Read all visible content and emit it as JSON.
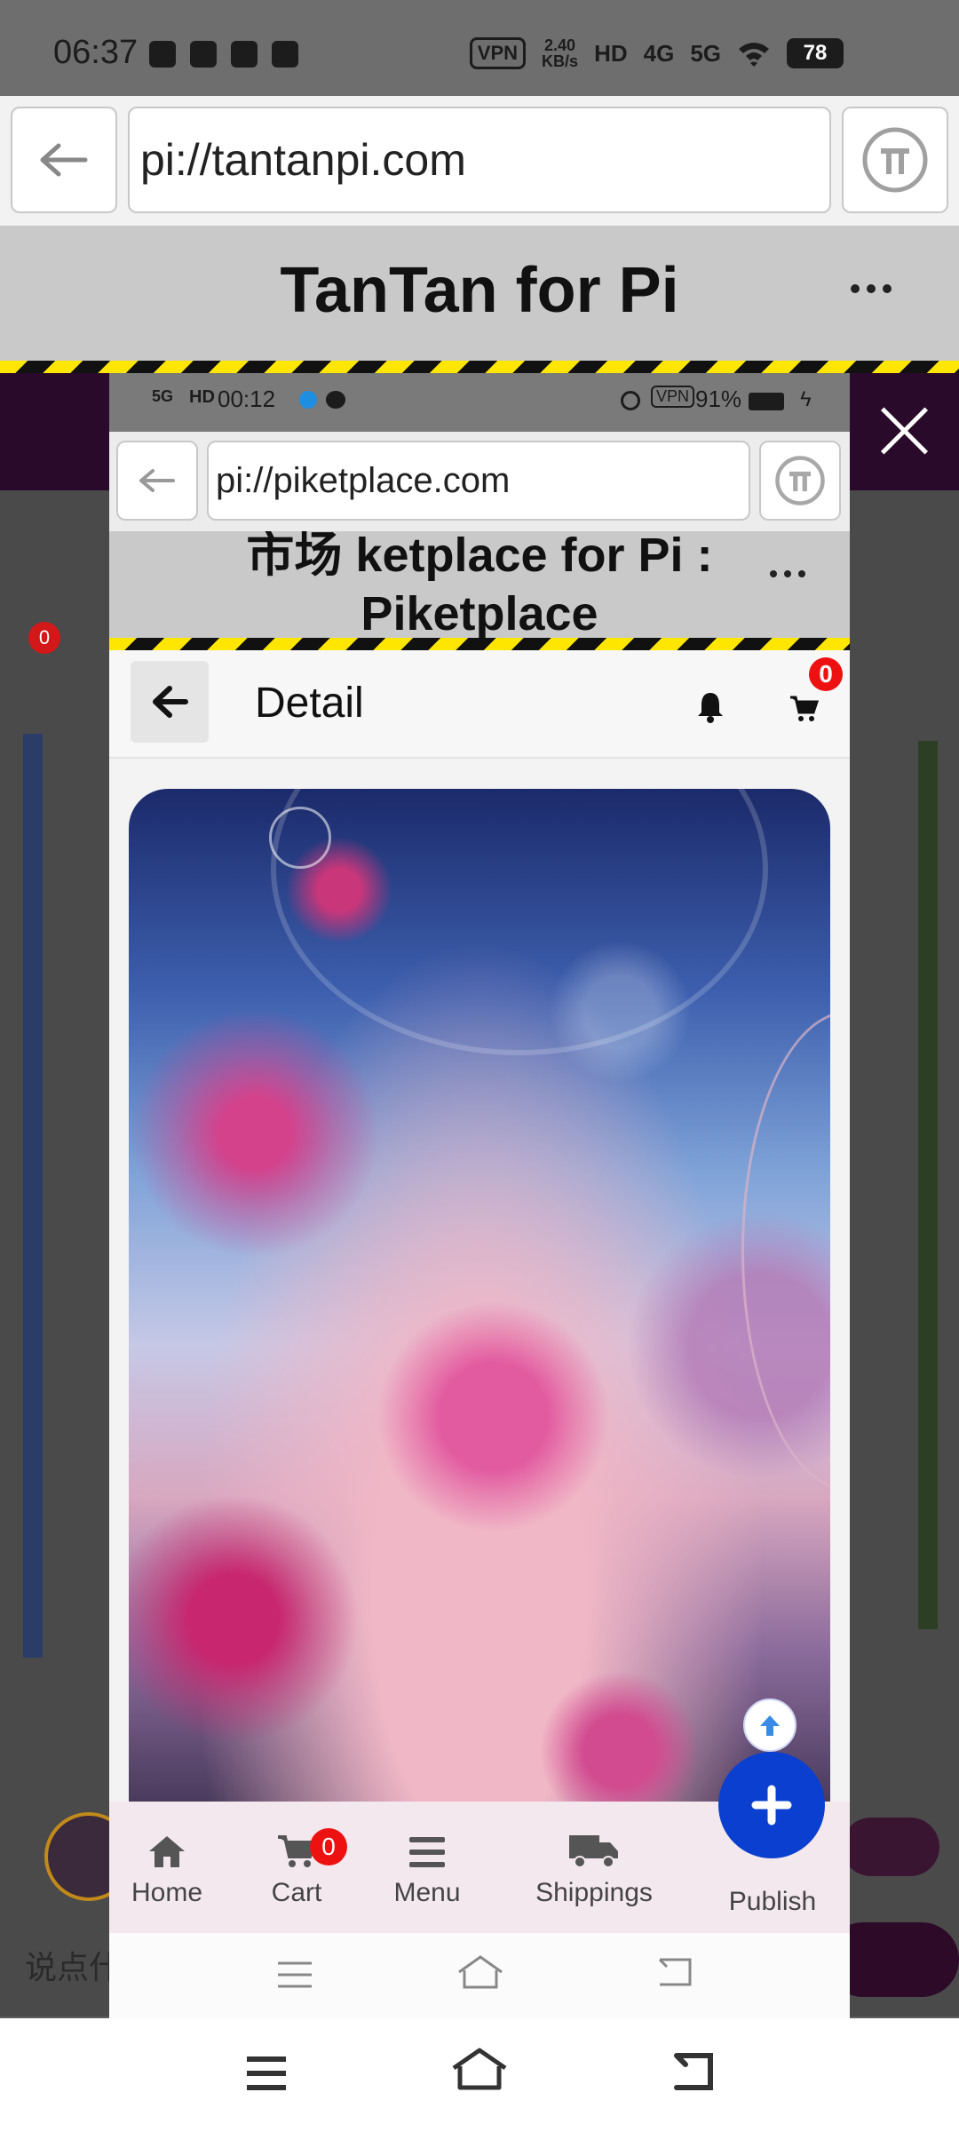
{
  "status_bar": {
    "time": "06:37",
    "vpn": "VPN",
    "speed": "2.40",
    "speed_unit": "KB/s",
    "hd": "HD",
    "net1": "4G",
    "net2": "5G",
    "battery": "78"
  },
  "outer_browser": {
    "url": "pi://tantanpi.com",
    "title": "TanTan for Pi"
  },
  "inner_status": {
    "time": "00:12",
    "net": "5G",
    "hd": "HD",
    "vpn": "VPN",
    "battery": "91%"
  },
  "inner_browser": {
    "url": "pi://piketplace.com",
    "title_line1": "市场 ketplace for Pi :",
    "title_line2": "Piketplace"
  },
  "detail": {
    "title": "Detail",
    "cart_count": "0"
  },
  "bottom_nav": [
    {
      "label": "Home",
      "icon": "home-icon"
    },
    {
      "label": "Cart",
      "icon": "cart-icon",
      "badge": "0"
    },
    {
      "label": "Menu",
      "icon": "menu-icon"
    },
    {
      "label": "Shippings",
      "icon": "truck-icon"
    },
    {
      "label": "Publish",
      "icon": "plus-icon"
    }
  ],
  "background": {
    "badge": "0",
    "input_placeholder": "说点什"
  },
  "colors": {
    "fab": "#0a3fcf",
    "badge": "#ee1111",
    "hazard_yellow": "#ffe600"
  }
}
